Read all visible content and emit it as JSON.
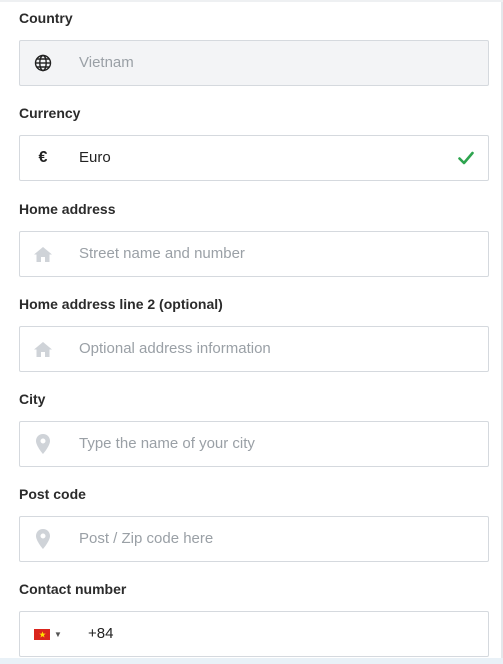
{
  "country": {
    "label": "Country",
    "value": "Vietnam",
    "icon": "globe-icon"
  },
  "currency": {
    "label": "Currency",
    "symbol": "€",
    "value": "Euro",
    "icon": "euro-icon",
    "valid": true,
    "check_color": "#2ea44f"
  },
  "home_address": {
    "label": "Home address",
    "placeholder": "Street name and number",
    "icon": "home-icon"
  },
  "home_address_2": {
    "label": "Home address line 2 (optional)",
    "placeholder": "Optional address information",
    "icon": "home-icon"
  },
  "city": {
    "label": "City",
    "placeholder": "Type the name of your city",
    "icon": "location-pin-icon"
  },
  "post_code": {
    "label": "Post code",
    "placeholder": "Post / Zip code here",
    "icon": "location-pin-icon"
  },
  "contact_number": {
    "label": "Contact number",
    "value": "+84",
    "flag": "vietnam-flag-icon",
    "flag_color": "#da251d"
  }
}
